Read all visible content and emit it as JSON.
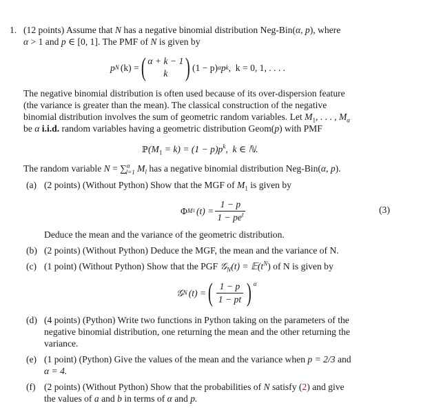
{
  "problem": {
    "number": "1.",
    "points": "(12 points)",
    "intro_line1_a": "Assume that",
    "intro_var_N": "N",
    "intro_line1_b": "has a negative binomial distribution Neg-Bin(",
    "alpha": "α",
    "p": "p",
    "intro_line1_c": "), where",
    "intro_line2_a": "> 1 and",
    "intro_line2_b": "∈ [0, 1]. The PMF of",
    "intro_line2_c": "is given by",
    "pmf_eq": {
      "lhs": "p",
      "lhs_sub": "N",
      "lhs_arg": "(k) =",
      "binom_top": "α + k − 1",
      "binom_bottom": "k",
      "rhs": "(1 − p)",
      "rhs_sup": "α",
      "rhs_p": "p",
      "rhs_sup_k": "k",
      "range": ",  k = 0, 1, . . . ."
    },
    "para_lines": [
      "The negative binomial distribution is often used because of its over-dispersion feature",
      "(the variance is greater than the mean).  The classical construction of the negative",
      "binomial distribution involves the sum of geometric random variables. Let"
    ],
    "para_line3_vars": "M",
    "para_line3_sub1": "1",
    "para_line3_dots": ", . . . ,",
    "para_line3_suba": "α",
    "para_line4_a": "be",
    "para_line4_iid": "i.i.d.",
    "para_line4_b": "random variables having a geometric distribution Geom(",
    "para_line4_c": ") with PMF",
    "geom_eq": {
      "P": "ℙ",
      "body_a": "(M",
      "sub1": "1",
      "body_b": " = k) = (1 − p)p",
      "sup_k": "k",
      "body_c": ",  k ∈ ℕ."
    },
    "sum_line": {
      "a": "The random variable",
      "N": "N",
      "eq": " = ",
      "sum": "∑",
      "sum_sup": "α",
      "sum_sub": "l=1",
      "M": "M",
      "M_sub": "l",
      "b": "has a negative binomial distribution Neg-Bin(",
      "c": ")."
    },
    "parts": [
      {
        "label": "(a)",
        "text": "(2 points)  (Without Python) Show that the MGF of",
        "var": "M",
        "var_sub": "1",
        "text_end": "is given by",
        "eq_lhs": "Φ",
        "eq_lhs_sub": "M",
        "eq_lhs_sub2": "1",
        "eq_lhs_arg": "(t) =",
        "eq_num": "1 − p",
        "eq_den": "1 − pe",
        "eq_den_sup": "t",
        "eq_number": "(3)",
        "follow": "Deduce the mean and the variance of the geometric distribution."
      },
      {
        "label": "(b)",
        "text": "(2 points)  (Without Python) Deduce the MGF, the mean and the variance of N."
      },
      {
        "label": "(c)",
        "text": "(1 point)  (Without Python) Show that the PGF",
        "pgf": "𝒢",
        "pgf_sub": "N",
        "pgf_mid": "(t) = 𝔼(t",
        "pgf_sup": "N",
        "text_end": ") of N is given by",
        "eq_lhs": "𝒢",
        "eq_lhs_sub": "N",
        "eq_lhs_arg": "(t) =",
        "eq_num": "1 − p",
        "eq_den": "1 − pt",
        "eq_sup": "α"
      },
      {
        "label": "(d)",
        "lines": [
          "(4 points)  (Python) Write two functions in Python taking on the parameters of the",
          "negative binomial distribution, one returning the mean and the other returning the",
          "variance."
        ]
      },
      {
        "label": "(e)",
        "line1": "(1 point)  (Python) Give the values of the mean and the variance when",
        "p_eq": "p = 2/3",
        "and": "and",
        "line2": "α = 4."
      },
      {
        "label": "(f)",
        "line1_a": "(2 points)  (Without Python) Show that the probabilities of",
        "N": "N",
        "line1_b": "satisfy (",
        "ref": "2",
        "line1_c": ") and give",
        "line2_a": "the values of",
        "a": "a",
        "line2_b": "and",
        "b": "b",
        "line2_c": "in terms of",
        "alpha": "α",
        "line2_d": "and",
        "p": "p."
      }
    ]
  }
}
